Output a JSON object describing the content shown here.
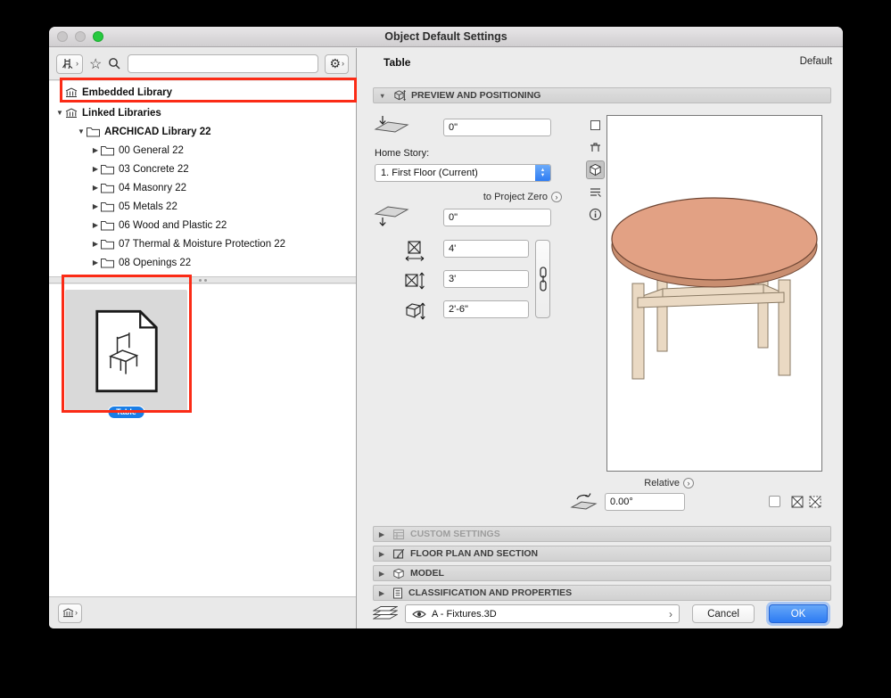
{
  "window": {
    "title": "Object Default Settings"
  },
  "icons": {
    "star": "☆",
    "gear": "⚙",
    "chevron": "›",
    "tri_down": "▼",
    "tri_right": "▶",
    "step_up": "▴",
    "step_down": "▾"
  },
  "left_panel": {
    "search": {
      "value": "",
      "placeholder": ""
    },
    "tree": {
      "items": [
        {
          "label": "Embedded Library"
        },
        {
          "label": "Linked Libraries"
        },
        {
          "label": "ARCHICAD Library 22"
        },
        {
          "label": "00 General 22"
        },
        {
          "label": "03 Concrete 22"
        },
        {
          "label": "04 Masonry 22"
        },
        {
          "label": "05 Metals 22"
        },
        {
          "label": "06 Wood and Plastic 22"
        },
        {
          "label": "07 Thermal & Moisture Protection 22"
        },
        {
          "label": "08 Openings 22"
        }
      ]
    },
    "item_badge": "Table"
  },
  "right_panel": {
    "header": {
      "title": "Table",
      "status": "Default"
    },
    "preview": {
      "section_title": "PREVIEW AND POSITIONING",
      "elevation_to_story": "0\"",
      "home_story_label": "Home Story:",
      "home_story_value": "1. First Floor (Current)",
      "to_project_zero_label": "to Project Zero",
      "elevation_to_zero": "0\"",
      "dim_width": "4'",
      "dim_depth": "3'",
      "dim_height": "2'-6\"",
      "relative_label": "Relative",
      "rotation_angle": "0.00°"
    },
    "sections": [
      {
        "title": "CUSTOM SETTINGS"
      },
      {
        "title": "FLOOR PLAN AND SECTION"
      },
      {
        "title": "MODEL"
      },
      {
        "title": "CLASSIFICATION AND PROPERTIES"
      }
    ],
    "footer": {
      "layer_value": "A - Fixtures.3D",
      "cancel_label": "Cancel",
      "ok_label": "OK"
    },
    "colors": {
      "accent_blue": "#2e7cf3",
      "annotation_red": "#fb2b16",
      "table_top": "#e2a184",
      "table_legs": "#ead9c3"
    }
  }
}
